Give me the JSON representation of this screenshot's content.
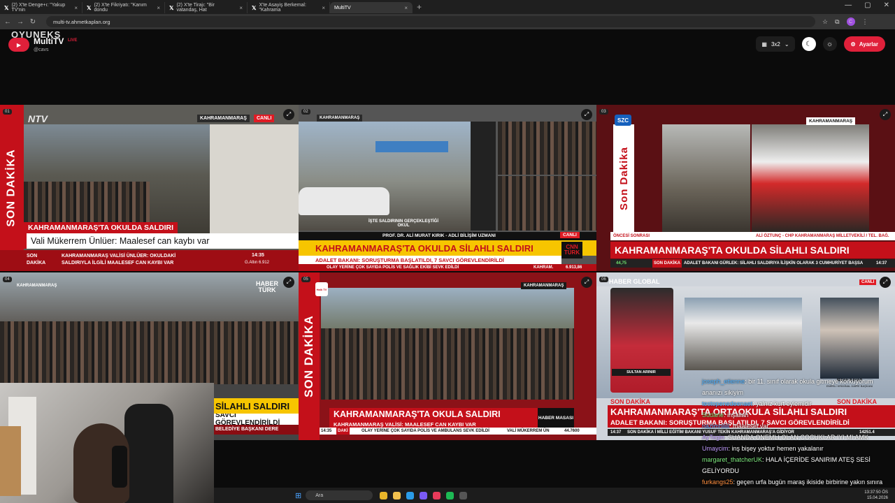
{
  "browser": {
    "tabs": [
      {
        "label": "(2) X'te Denge+ı: \"Yakup TV'nin"
      },
      {
        "label": "(2) X'te Fikriyatı: \"Kanım dondu"
      },
      {
        "label": "(2) X'te Tirajı: \"Bir vatandaş, Hat"
      },
      {
        "label": "X'te Asayiş Berkemal: \"Kahrama"
      },
      {
        "label": "MultiTV",
        "active": true
      }
    ],
    "url": "multi-tv.ahmetkaplan.org"
  },
  "app": {
    "name": "MultiTV",
    "live": "LIVE",
    "handle": "@cavs",
    "overlay": "OYUNEKS",
    "grid_label": "3x2",
    "settings_label": "Ayarlar"
  },
  "streams": [
    {
      "num": "01",
      "channel": "NTV",
      "location": "KAHRAMANMARAŞ",
      "canli": "CANLI",
      "side": "SON DAKİKA",
      "headline": "KAHRAMANMARAŞ'TA OKULDA SALDIRI",
      "sub": "Vali Mükerrem Ünlüer: Maalesef can kaybı var",
      "ticker_left": "SON DAKİKA",
      "ticker": "KAHRAMANMARAŞ VALİSİ ÜNLÜER: OKULDAKİ SALDIRIYLA İLGİLİ MAALESEF CAN KAYBI VAR",
      "time": "14:35",
      "index": "G.Altın 6.912"
    },
    {
      "num": "02",
      "location": "KAHRAMANMARAŞ",
      "caption": "İŞTE SALDIRININ GERÇEKLEŞTİĞİ OKUL",
      "guest": "PROF. DR. ALİ MURAT KIRIK - ADLİ BİLİŞİM UZMANI",
      "canli": "CANLI",
      "channel": "CNN TÜRK",
      "headline": "KAHRAMANMARAŞ'TA OKULDA SİLAHLI SALDIRI",
      "sub": "ADALET BAKANI: SORUŞTURMA BAŞLATILDI, 7 SAVCI GÖREVLENDİRİLDİ",
      "ticker": "OLAY YERİNE ÇOK SAYIDA POLİS VE SAĞLIK EKİBİ SEVK EDİLDİ",
      "ticker_tag": "KAHRAM.",
      "index": "6.913,86"
    },
    {
      "num": "03",
      "channel": "SZC",
      "location": "KAHRAMANMARAŞ",
      "side": "Son Dakika",
      "left_label": "ÖNCESİ SONRASI",
      "guest": "ALİ ÖZTUNÇ - CHP KAHRAMANMARAŞ MİLLETVEKİLİ / TEL. BAĞ.",
      "headline": "KAHRAMANMARAŞ'TA OKULDA SİLAHLI SALDIRI",
      "index": "44,75",
      "ticker_tag": "SON DAKİKA",
      "ticker": "ADALET BAKANI GÜRLEK: SİLAHLI SALDIRIYA İLİŞKİN OLARAK 3 CUMHURİYET BAŞSA",
      "time": "14:37"
    },
    {
      "num": "04",
      "location": "KAHRAMANMARAŞ",
      "channel": "HABER TÜRK",
      "headline": "SİLAHLI SALDIRI",
      "sub": "SAVCI GÖREVLENDİRİLDİ",
      "ticker": "BELEDİYE BAŞKANI DERE"
    },
    {
      "num": "05",
      "channel": "Halk TV",
      "location": "KAHRAMANMARAŞ",
      "side": "SON DAKİKA",
      "headline": "KAHRAMANMARAŞ'TA OKULA SALDIRI",
      "sub": "KAHRAMANMARAŞ VALİSİ: MAALESEF CAN KAYBI VAR",
      "tag": "HABER MASASI",
      "time": "14:35",
      "ticker_tag": "DAKİ",
      "ticker": "OLAY YERİNE ÇOK SAYIDA POLİS VE AMBULANS SEVK EDİLDİ",
      "ticker2": "VALİ MÜKERREM ÜN",
      "index": "44.7600"
    },
    {
      "num": "06",
      "channel": "HABER GLOBAL",
      "canli": "CANLI",
      "anchor": "SULTAN ARINIR",
      "guest": "İRFAN BAYAR",
      "guest_title": "EMEKLİ KRİMİNAL DAİRE BAŞKANI",
      "sd_left": "SON DAKİKA",
      "sd_right": "SON DAKİKA",
      "headline": "KAHRAMANMARAŞ'TA ORTAOKULA SİLAHLI SALDIRI",
      "sub": "ADALET BAKANI: SORUŞTURMA BAŞLATILDI, 7 SAVCI GÖREVLENDİRİLDİ",
      "time": "14:37",
      "ticker": "SON DAKİKA  İ MİLLİ EĞİTİM BAKANI YUSUF TEKİN KAHRAMANMARAŞ'A GİDİYOR",
      "index": "14251.4"
    }
  ],
  "chat": [
    {
      "user": "joseph_etienne",
      "text": ": bir 11. sınıf olarak okula gitmeye korkuyorum ananızı sikiyim",
      "cls": "u1"
    },
    {
      "user": "testopenedeenaet",
      "text": ": yalnız kurt eylemidir",
      "cls": "u1"
    },
    {
      "user": "Sudane",
      "text": ": inşallah",
      "cls": "u4"
    },
    {
      "user": "nazimniiiii",
      "text": ": maalesef var",
      "cls": "u1"
    },
    {
      "user": "AyTegin",
      "text": ": SUANDA ONEMLI OLAN COCUKLAR IYI MI AMK",
      "cls": "u5"
    },
    {
      "user": "Umaycim",
      "text": ": inş bişey yoktur hemen yakalanır",
      "cls": "u5"
    },
    {
      "user": "margaret_thatcherUK",
      "text": ": HALA İÇERİDE SANIRIM ATEŞ SESİ GELİYORDU",
      "cls": "u4"
    },
    {
      "user": "furkangs25",
      "text": ": geçen urfa bugün maraş ikiside birbirine yakın sınıra yakın",
      "cls": "u3"
    }
  ],
  "taskbar": {
    "search": "Ara",
    "time": "13:37:50 ÖS",
    "date": "15.04.2026"
  }
}
